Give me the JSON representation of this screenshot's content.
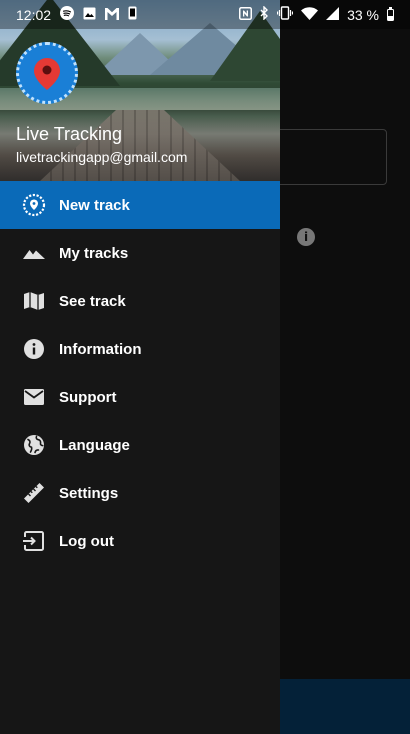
{
  "status_bar": {
    "time": "12:02",
    "battery": "33 %",
    "battery_level": 0.33,
    "left_icons": [
      "spotify-icon",
      "gallery-icon",
      "gmail-icon",
      "phone-icon"
    ],
    "right_icons": [
      "nfc-icon",
      "bluetooth-icon",
      "vibrate-icon",
      "wifi-icon",
      "signal-icon",
      "battery-icon"
    ]
  },
  "drawer": {
    "header": {
      "user_name": "Live Tracking",
      "user_email": "livetrackingapp@gmail.com",
      "logo_icon": "location-pin-icon"
    },
    "items": [
      {
        "label": "New track",
        "icon": "new-track-icon",
        "active": true
      },
      {
        "label": "My tracks",
        "icon": "mountain-icon",
        "active": false
      },
      {
        "label": "See track",
        "icon": "map-icon",
        "active": false
      },
      {
        "label": "Information",
        "icon": "info-icon",
        "active": false
      },
      {
        "label": "Support",
        "icon": "mail-icon",
        "active": false
      },
      {
        "label": "Language",
        "icon": "globe-icon",
        "active": false
      },
      {
        "label": "Settings",
        "icon": "ruler-icon",
        "active": false
      },
      {
        "label": "Log out",
        "icon": "logout-icon",
        "active": false
      }
    ]
  },
  "colors": {
    "accent": "#0a6ab8",
    "drawer_bg": "#161616",
    "logo_blue": "#1a7fd6",
    "pin_red": "#e53935",
    "bottom_bar": "#042138"
  }
}
